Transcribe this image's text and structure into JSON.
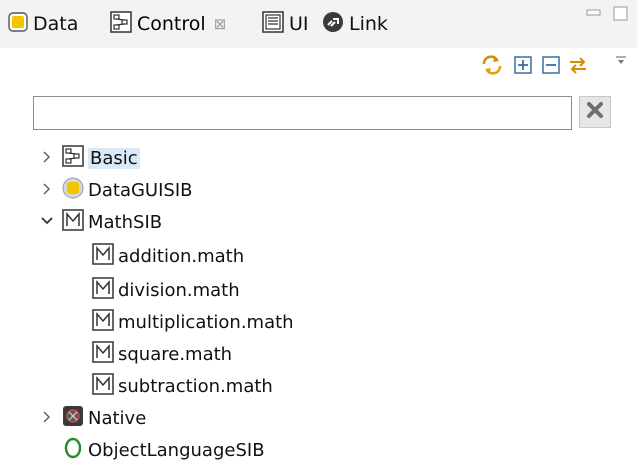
{
  "tabs": [
    {
      "label": "Data",
      "icon": "data-icon"
    },
    {
      "label": "Control",
      "icon": "control-icon",
      "active": true,
      "close_symbol": "⊠"
    },
    {
      "label": "UI",
      "icon": "ui-icon"
    },
    {
      "label": "Link",
      "icon": "link-icon"
    }
  ],
  "search": {
    "value": "",
    "placeholder": ""
  },
  "tree": {
    "basic": {
      "label": "Basic"
    },
    "datagui": {
      "label": "DataGUISIB"
    },
    "mathsib": {
      "label": "MathSIB"
    },
    "math_children": [
      {
        "label": "addition.math"
      },
      {
        "label": "division.math"
      },
      {
        "label": "multiplication.math"
      },
      {
        "label": "square.math"
      },
      {
        "label": "subtraction.math"
      }
    ],
    "native": {
      "label": "Native"
    },
    "objectlang": {
      "label": "ObjectLanguageSIB"
    }
  },
  "colors": {
    "accent_green": "#2e8b2e",
    "data_yellow": "#f5c400",
    "selection": "#d9e9f7"
  }
}
